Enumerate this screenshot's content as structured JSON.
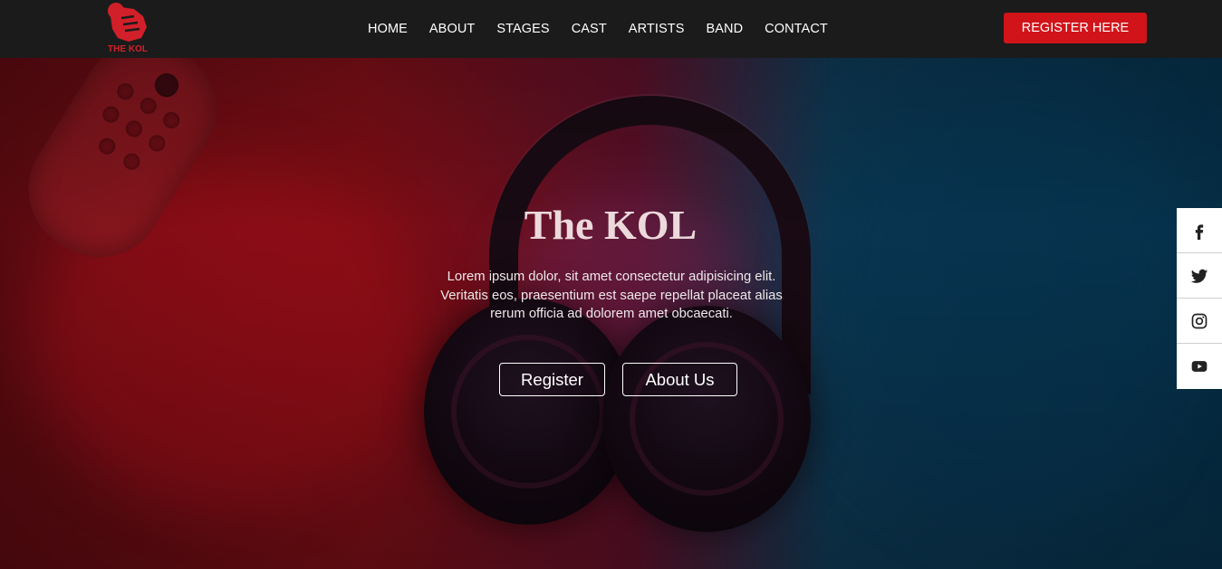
{
  "brand": {
    "logo_text": "THE KOL",
    "accent": "#d0141a"
  },
  "nav": {
    "links": [
      {
        "label": "HOME"
      },
      {
        "label": "ABOUT"
      },
      {
        "label": "STAGES"
      },
      {
        "label": "CAST"
      },
      {
        "label": "ARTISTS"
      },
      {
        "label": "BAND"
      },
      {
        "label": "CONTACT"
      }
    ],
    "register_label": "REGISTER HERE"
  },
  "hero": {
    "title": "The KOL",
    "description": "Lorem ipsum dolor, sit amet consectetur adipisicing elit. Veritatis eos, praesentium est saepe repellat placeat alias rerum officia ad dolorem amet obcaecati.",
    "buttons": {
      "register": "Register",
      "about": "About Us"
    }
  },
  "social": [
    {
      "icon": "facebook-icon"
    },
    {
      "icon": "twitter-icon"
    },
    {
      "icon": "instagram-icon"
    },
    {
      "icon": "youtube-icon"
    }
  ],
  "colors": {
    "navbar_bg": "#1b1b1b",
    "hero_red": "#7a0f16",
    "hero_blue": "#063049",
    "title_color": "#ecd9dc"
  }
}
